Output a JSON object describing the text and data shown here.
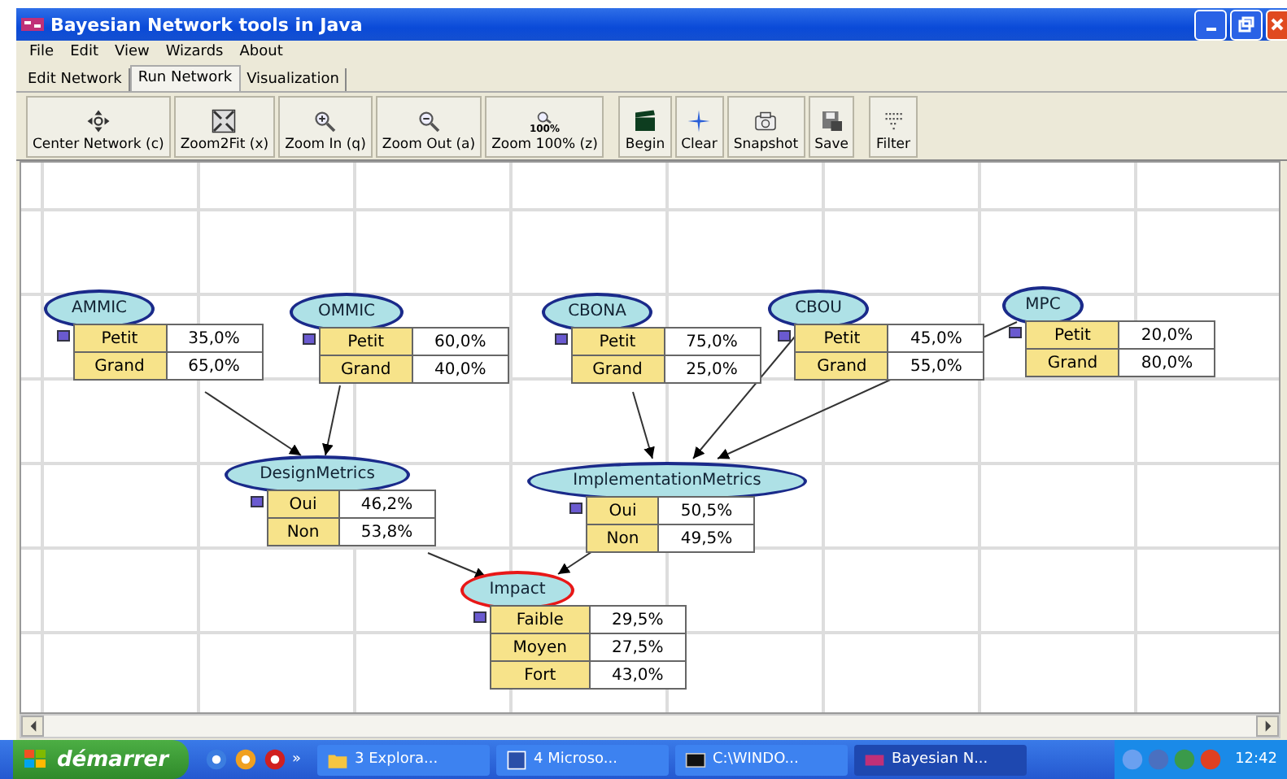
{
  "window": {
    "title": "Bayesian Network tools in Java"
  },
  "menu": [
    "File",
    "Edit",
    "View",
    "Wizards",
    "About"
  ],
  "tabs": [
    {
      "label": "Edit Network",
      "selected": false
    },
    {
      "label": "Run Network",
      "selected": true
    },
    {
      "label": "Visualization",
      "selected": false
    }
  ],
  "toolbar": [
    {
      "kind": "move",
      "label": "Center Network (c)"
    },
    {
      "kind": "fit",
      "label": "Zoom2Fit (x)"
    },
    {
      "kind": "zoomin",
      "label": "Zoom In (q)"
    },
    {
      "kind": "zoomout",
      "label": "Zoom Out (a)"
    },
    {
      "kind": "zoom100",
      "label": "Zoom 100% (z)",
      "icon_text": "100%"
    },
    {
      "kind": "separator"
    },
    {
      "kind": "clapper",
      "label": "Begin"
    },
    {
      "kind": "star",
      "label": "Clear"
    },
    {
      "kind": "camera",
      "label": "Snapshot"
    },
    {
      "kind": "disk",
      "label": "Save"
    },
    {
      "kind": "separator"
    },
    {
      "kind": "dots",
      "label": "Filter"
    }
  ],
  "network": {
    "nodes": [
      {
        "name": "AMMIC",
        "selected": false,
        "states": [
          {
            "label": "Petit",
            "value": "35,0%"
          },
          {
            "label": "Grand",
            "value": "65,0%"
          }
        ]
      },
      {
        "name": "OMMIC",
        "selected": false,
        "states": [
          {
            "label": "Petit",
            "value": "60,0%"
          },
          {
            "label": "Grand",
            "value": "40,0%"
          }
        ]
      },
      {
        "name": "CBONA",
        "selected": false,
        "states": [
          {
            "label": "Petit",
            "value": "75,0%"
          },
          {
            "label": "Grand",
            "value": "25,0%"
          }
        ]
      },
      {
        "name": "CBOU",
        "selected": false,
        "states": [
          {
            "label": "Petit",
            "value": "45,0%"
          },
          {
            "label": "Grand",
            "value": "55,0%"
          }
        ]
      },
      {
        "name": "MPC",
        "selected": false,
        "states": [
          {
            "label": "Petit",
            "value": "20,0%"
          },
          {
            "label": "Grand",
            "value": "80,0%"
          }
        ]
      },
      {
        "name": "DesignMetrics",
        "selected": false,
        "states": [
          {
            "label": "Oui",
            "value": "46,2%"
          },
          {
            "label": "Non",
            "value": "53,8%"
          }
        ]
      },
      {
        "name": "ImplementationMetrics",
        "selected": false,
        "states": [
          {
            "label": "Oui",
            "value": "50,5%"
          },
          {
            "label": "Non",
            "value": "49,5%"
          }
        ]
      },
      {
        "name": "Impact",
        "selected": true,
        "states": [
          {
            "label": "Faible",
            "value": "29,5%"
          },
          {
            "label": "Moyen",
            "value": "27,5%"
          },
          {
            "label": "Fort",
            "value": "43,0%"
          }
        ]
      }
    ]
  },
  "taskbar": {
    "start": "démarrer",
    "more": "»",
    "items": [
      {
        "kind": "folder",
        "label": "3 Explora...",
        "selected": false
      },
      {
        "kind": "word",
        "label": "4 Microso...",
        "selected": false
      },
      {
        "kind": "console",
        "label": "C:\\WINDO...",
        "selected": false
      },
      {
        "kind": "app",
        "label": "Bayesian N...",
        "selected": true
      }
    ],
    "clock": "12:42"
  }
}
